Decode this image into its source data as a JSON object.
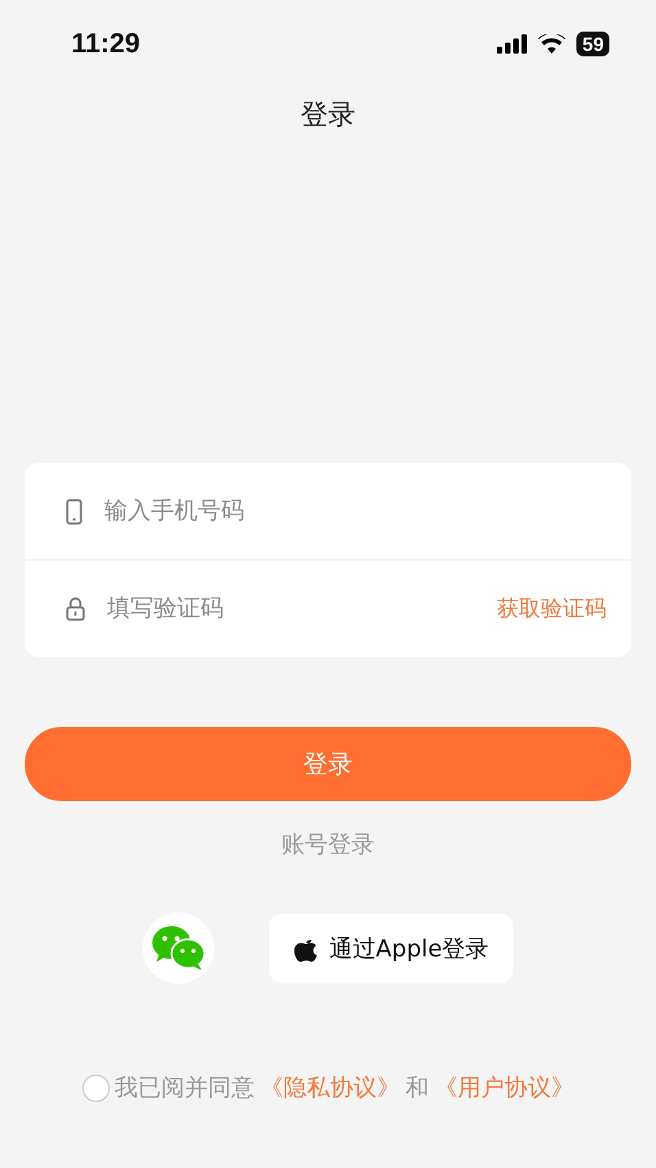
{
  "status_bar": {
    "time": "11:29",
    "battery": "59"
  },
  "title": "登录",
  "form": {
    "phone": {
      "placeholder": "输入手机号码"
    },
    "code": {
      "placeholder": "填写验证码",
      "action": "获取验证码"
    }
  },
  "login_button": "登录",
  "account_login": "账号登录",
  "social": {
    "apple_button": "通过Apple登录"
  },
  "agreement": {
    "checked": false,
    "prefix": "我已阅并同意",
    "privacy": "《隐私协议》",
    "joiner": "和",
    "terms": "《用户协议》"
  }
}
